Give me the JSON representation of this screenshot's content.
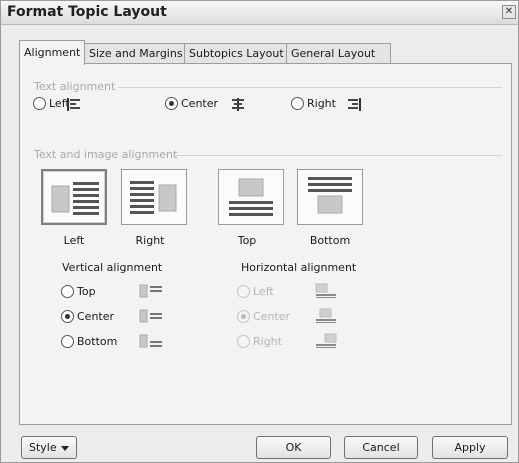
{
  "window": {
    "title": "Format Topic Layout",
    "close_icon": "close-icon"
  },
  "tabs": [
    {
      "label": "Alignment",
      "active": true
    },
    {
      "label": "Size and Margins",
      "active": false
    },
    {
      "label": "Subtopics Layout",
      "active": false
    },
    {
      "label": "General Layout",
      "active": false
    }
  ],
  "text_alignment": {
    "group_label": "Text alignment",
    "options": [
      {
        "label": "Left",
        "selected": false,
        "icon": "align-left-icon"
      },
      {
        "label": "Center",
        "selected": true,
        "icon": "align-center-icon"
      },
      {
        "label": "Right",
        "selected": false,
        "icon": "align-right-icon"
      }
    ]
  },
  "text_image_alignment": {
    "group_label": "Text and image alignment",
    "layouts": [
      {
        "label": "Left",
        "selected": true,
        "icon": "image-left-text-icon"
      },
      {
        "label": "Right",
        "selected": false,
        "icon": "image-right-text-icon"
      },
      {
        "label": "Top",
        "selected": false,
        "icon": "image-top-text-icon"
      },
      {
        "label": "Bottom",
        "selected": false,
        "icon": "image-bottom-text-icon"
      }
    ],
    "vertical": {
      "label": "Vertical alignment",
      "options": [
        {
          "label": "Top",
          "selected": false,
          "icon": "valign-top-icon"
        },
        {
          "label": "Center",
          "selected": true,
          "icon": "valign-center-icon"
        },
        {
          "label": "Bottom",
          "selected": false,
          "icon": "valign-bottom-icon"
        }
      ]
    },
    "horizontal": {
      "label": "Horizontal alignment",
      "enabled": false,
      "options": [
        {
          "label": "Left",
          "selected": false,
          "icon": "halign-left-icon"
        },
        {
          "label": "Center",
          "selected": true,
          "icon": "halign-center-icon"
        },
        {
          "label": "Right",
          "selected": false,
          "icon": "halign-right-icon"
        }
      ]
    }
  },
  "footer": {
    "style_label": "Style",
    "ok_label": "OK",
    "cancel_label": "Cancel",
    "apply_label": "Apply"
  }
}
